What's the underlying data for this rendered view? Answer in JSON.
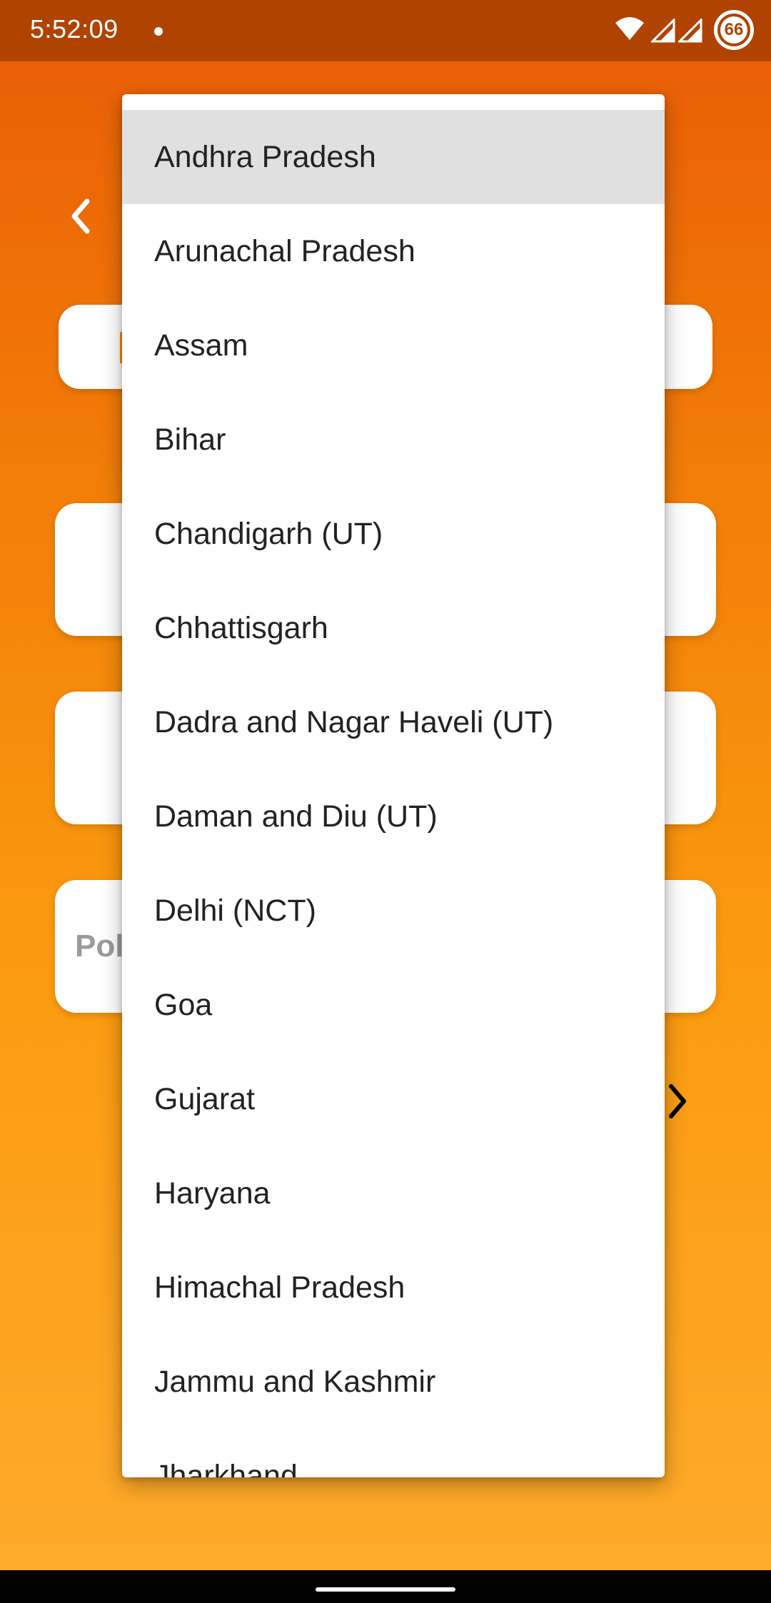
{
  "status_bar": {
    "time": "5:52:09",
    "battery": "66"
  },
  "background_form": {
    "partial_field_label": "Pol"
  },
  "dropdown": {
    "selected": "Andhra Pradesh",
    "items": [
      "Andhra Pradesh",
      "Arunachal Pradesh",
      "Assam",
      "Bihar",
      "Chandigarh (UT)",
      "Chhattisgarh",
      "Dadra and Nagar Haveli (UT)",
      "Daman and Diu (UT)",
      "Delhi (NCT)",
      "Goa",
      "Gujarat",
      "Haryana",
      "Himachal Pradesh",
      "Jammu and Kashmir",
      "Jharkhand"
    ]
  },
  "colors": {
    "status_bar": "#b04300",
    "gradient_top": "#e85c05",
    "gradient_bottom": "#fdaa2a",
    "selected_item": "#e0e0e0"
  }
}
